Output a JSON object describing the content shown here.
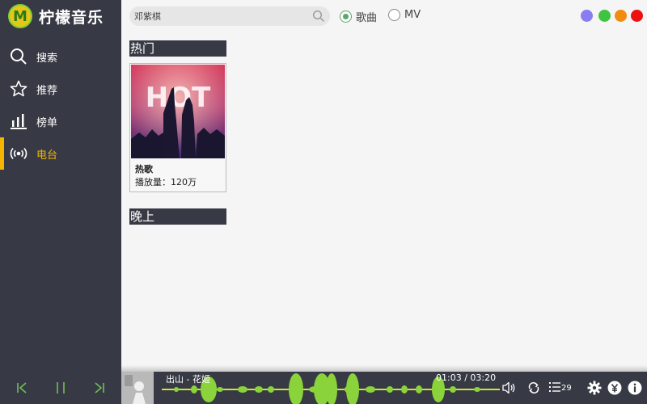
{
  "app": {
    "logo_letter": "M",
    "title": "柠檬音乐"
  },
  "sidebar": {
    "items": [
      {
        "label": "搜索",
        "icon": "search-icon"
      },
      {
        "label": "推荐",
        "icon": "star-icon"
      },
      {
        "label": "榜单",
        "icon": "chart-bars-icon"
      },
      {
        "label": "电台",
        "icon": "radio-broadcast-icon",
        "active": true
      }
    ]
  },
  "search": {
    "value": "邓紫棋"
  },
  "search_type": {
    "options": [
      {
        "label": "歌曲",
        "selected": true
      },
      {
        "label": "MV",
        "selected": false
      }
    ]
  },
  "window_controls": {
    "colors": [
      "#8a7cf2",
      "#3ec43e",
      "#f28c0e",
      "#ee1111"
    ]
  },
  "sections": [
    {
      "title": "热门",
      "cards": [
        {
          "title": "热歌",
          "plays_label": "播放量：",
          "plays": "120万",
          "image_text": "HOT"
        }
      ]
    },
    {
      "title": "晚上",
      "cards": []
    }
  ],
  "player": {
    "song": "出山 - 花姬",
    "time": "01:03 / 03:20",
    "playlist_count": "29",
    "accent": "#8bd33a"
  }
}
